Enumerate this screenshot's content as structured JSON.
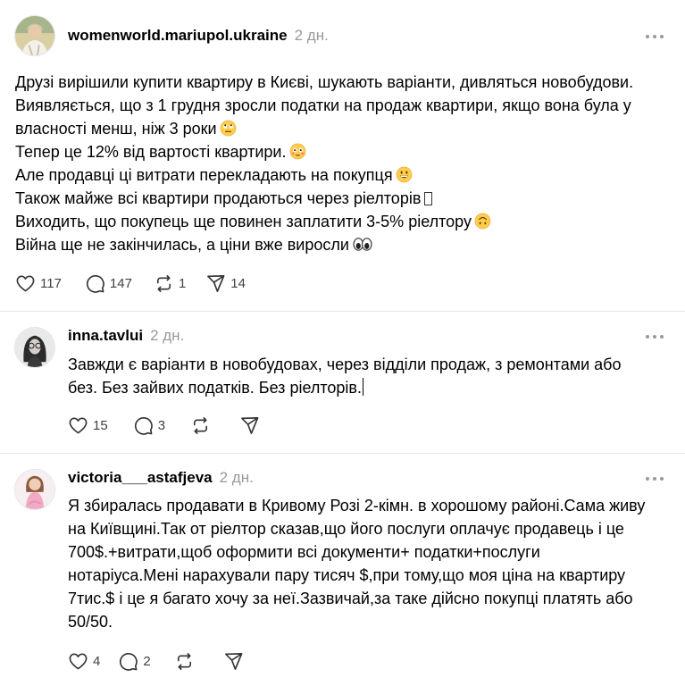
{
  "posts": [
    {
      "username": "womenworld.mariupol.ukraine",
      "time": "2 дн.",
      "avatar_icon": "profile-photo-woman",
      "lines": [
        "Друзі вирішили купити квартиру в Києві, шукають варіанти, дивляться новобудови.",
        "Виявляється, що з 1 грудня зросли податки на продаж квартири, якщо вона була у",
        "власності менш, ніж 3 роки",
        "Тепер це 12% від вартості квартири.",
        "Але продавці ці витрати перекладають на покупця",
        "Також майже всі квартири продаються через ріелторів",
        "Виходить, що покупець ще повинен заплатити 3-5% ріелтору",
        "Війна ще не закінчилась, а ціни вже виросли"
      ],
      "emojis": [
        "face-with-rolling-eyes-emoji",
        "flushed-face-emoji",
        "grinning-face-emoji",
        "unsupported-glyph-box",
        "upside-down-face-emoji",
        "eyes-emoji"
      ],
      "likes": "117",
      "replies": "147",
      "reposts": "1",
      "shares": "14"
    },
    {
      "username": "inna.tavlui",
      "time": "2 дн.",
      "avatar_icon": "profile-photo-woman-dark",
      "lines": [
        "Завжди є варіанти в новобудовах, через відділи продаж, з ремонтами або",
        "без. Без зайвих податків. Без ріелторів."
      ],
      "likes": "15",
      "replies": "3",
      "reposts": "",
      "shares": ""
    },
    {
      "username": "victoria___astafjeva",
      "time": "2 дн.",
      "avatar_icon": "profile-photo-girl-in-dress",
      "lines": [
        "Я збиралась продавати в Кривому Розі 2-кімн. в хорошому районі.Сама живу",
        "на Київщині.Так от ріелтор сказав,що його послуги оплачує продавець і це",
        "700$.+витрати,щоб оформити всі документи+ податки+послуги",
        "нотаріуса.Мені нарахували пару тисяч $,при тому,що моя ціна на квартиру",
        "7тис.$ і це я багато хочу за неї.Зазвичай,за таке дійсно покупці платять або",
        "50/50."
      ],
      "likes": "4",
      "replies": "2",
      "reposts": "",
      "shares": ""
    }
  ],
  "colors": {
    "text": "#000000",
    "muted": "#999999",
    "divider": "#e5e5e5",
    "emoji_yellow": "#ffcc4d"
  }
}
